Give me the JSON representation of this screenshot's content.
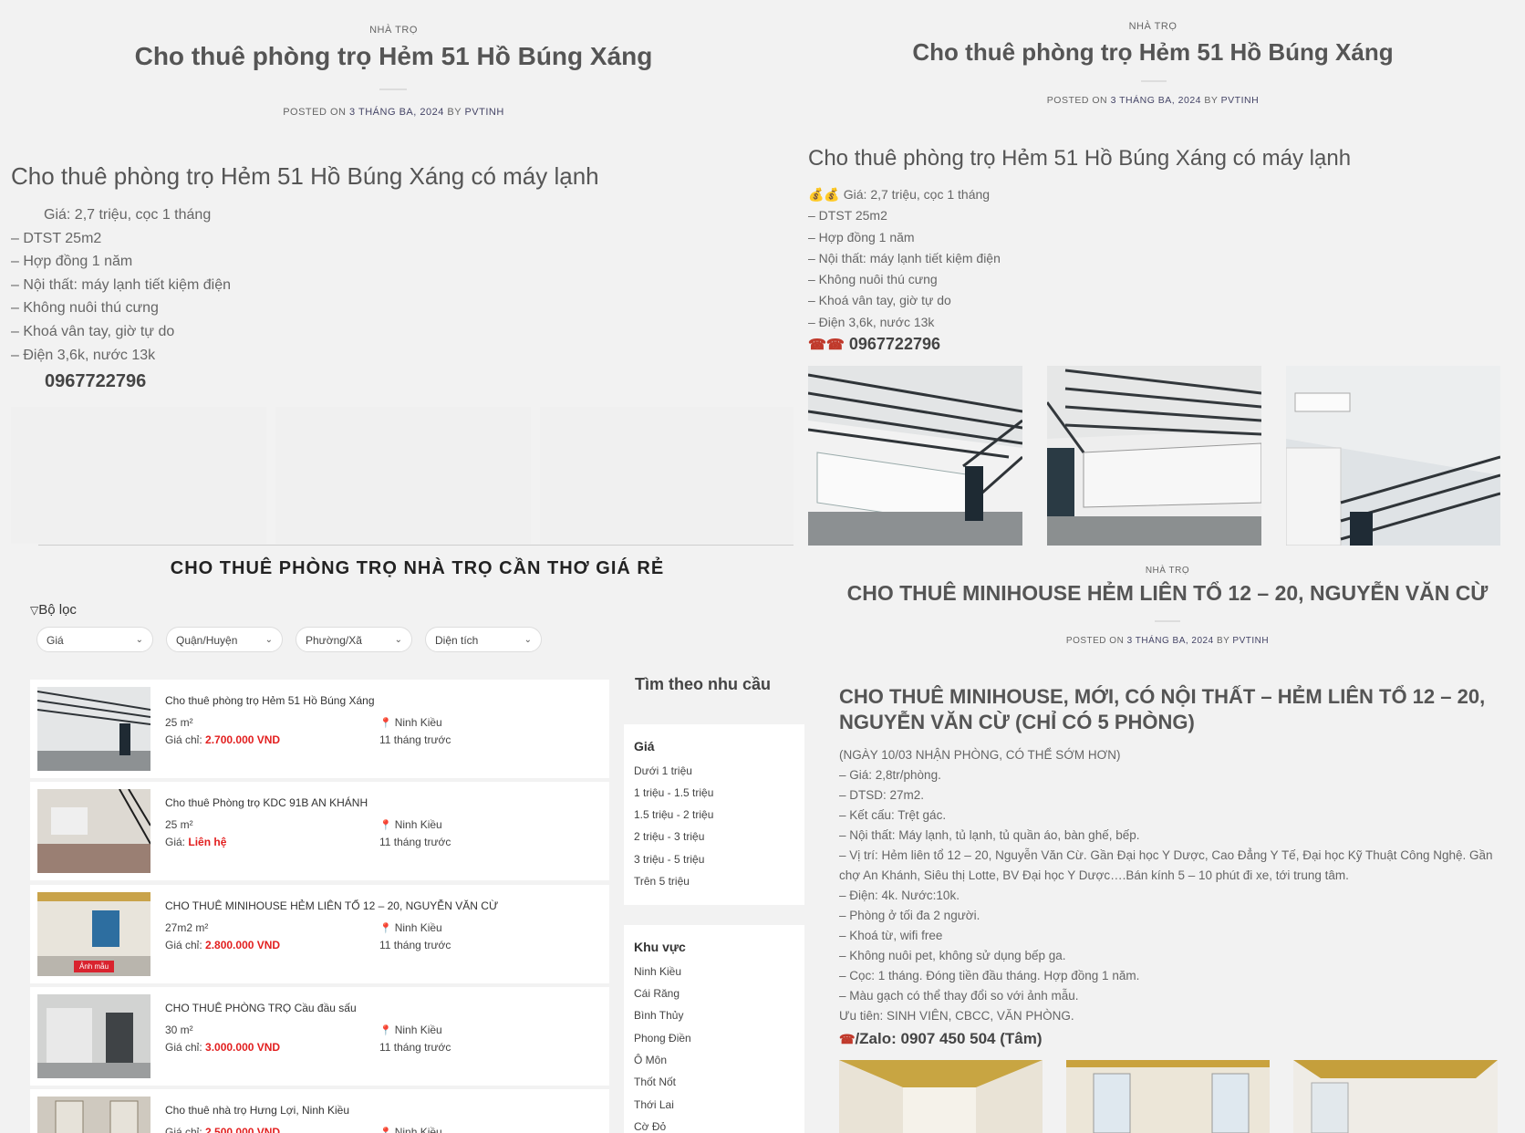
{
  "post1": {
    "category": "NHÀ TRỌ",
    "title": "Cho thuê phòng trọ Hẻm 51 Hồ Búng Xáng",
    "meta_prefix": "POSTED ON",
    "date": "3 THÁNG BA, 2024",
    "meta_by": "BY",
    "author": "PVTINH",
    "heading": "Cho thuê phòng trọ Hẻm 51 Hồ Búng Xáng có máy lạnh",
    "lines": [
      "Giá: 2,7 triệu, cọc 1 tháng",
      "– DTST 25m2",
      "– Hợp đồng 1 năm",
      "– Nội thất: máy lạnh tiết kiệm điện",
      "– Không nuôi thú cưng",
      "– Khoá vân tay, giờ tự do",
      "– Điện 3,6k, nước 13k"
    ],
    "phone": "0967722796"
  },
  "post2": {
    "category": "NHÀ TRỌ",
    "title": "Cho thuê phòng trọ Hẻm 51 Hồ Búng Xáng",
    "meta_prefix": "POSTED ON",
    "date": "3 THÁNG BA, 2024",
    "meta_by": "BY",
    "author": "PVTINH",
    "heading": "Cho thuê phòng trọ Hẻm 51 Hồ Búng Xáng có máy lạnh",
    "lines": [
      "💰💰 Giá: 2,7 triệu, cọc 1 tháng",
      "– DTST 25m2",
      "– Hợp đồng 1 năm",
      "– Nội thất: máy lạnh tiết kiệm điện",
      "– Không nuôi thú cưng",
      "– Khoá vân tay, giờ tự do",
      "– Điện 3,6k, nước 13k"
    ],
    "phone_icon": "☎☎",
    "phone": "0967722796"
  },
  "listing": {
    "title": "CHO THUÊ PHÒNG TRỌ NHÀ TRỌ CẦN THƠ GIÁ RẺ",
    "filter_label": "Bộ lọc",
    "filters": [
      "Giá",
      "Quận/Huyện",
      "Phường/Xã",
      "Diện tích"
    ],
    "cards": [
      {
        "title": "Cho thuê phòng trọ Hẻm 51 Hồ Búng Xáng",
        "area": "25 m²",
        "price_label": "Giá chỉ:",
        "price": "2.700.000 VND",
        "location": "Ninh Kiều",
        "time": "11 tháng trước"
      },
      {
        "title": "Cho thuê Phòng trọ KDC 91B AN KHÁNH",
        "area": "25 m²",
        "price_label": "Giá:",
        "price": "Liên hệ",
        "location": "Ninh Kiều",
        "time": "11 tháng trước"
      },
      {
        "title": "CHO THUÊ MINIHOUSE HẺM LIÊN TỔ 12 – 20, NGUYỄN VĂN CỪ",
        "area": "27m2 m²",
        "price_label": "Giá chỉ:",
        "price": "2.800.000 VND",
        "location": "Ninh Kiều",
        "time": "11 tháng trước",
        "badge": "Ảnh mẫu"
      },
      {
        "title": "CHO THUÊ PHÒNG TRỌ Cầu đầu sấu",
        "area": "30 m²",
        "price_label": "Giá chỉ:",
        "price": "3.000.000 VND",
        "location": "Ninh Kiều",
        "time": "11 tháng trước"
      },
      {
        "title": "Cho thuê nhà trọ Hưng Lợi, Ninh Kiều",
        "area": "",
        "price_label": "Giá chỉ:",
        "price": "2.500.000 VND",
        "location": "Ninh Kiều",
        "time": ""
      }
    ]
  },
  "sidebar": {
    "title": "Tìm theo nhu cầu",
    "price_title": "Giá",
    "price_items": [
      "Dưới 1 triệu",
      "1 triệu - 1.5 triệu",
      "1.5 triệu - 2 triệu",
      "2 triệu - 3 triệu",
      "3 triệu - 5 triệu",
      "Trên 5 triệu"
    ],
    "area_title": "Khu vực",
    "area_items": [
      "Ninh Kiều",
      "Cái Răng",
      "Bình Thủy",
      "Phong Điền",
      "Ô Môn",
      "Thốt Nốt",
      "Thới Lai",
      "Cờ Đỏ"
    ]
  },
  "post3": {
    "category": "NHÀ TRỌ",
    "title": "CHO THUÊ MINIHOUSE HẺM LIÊN TỔ 12 – 20, NGUYỄN VĂN CỪ",
    "meta_prefix": "POSTED ON",
    "date": "3 THÁNG BA, 2024",
    "meta_by": "BY",
    "author": "PVTINH",
    "heading_line1": "CHO THUÊ MINIHOUSE, MỚI, CÓ NỘI THẤT – HẺM LIÊN TỔ 12 – 20,",
    "heading_line2": "NGUYỄN VĂN CỪ (CHỈ CÓ 5 PHÒNG)",
    "lines": [
      "(NGÀY 10/03 NHẬN PHÒNG, CÓ THỂ SỚM HƠN)",
      "– Giá: 2,8tr/phòng.",
      "– DTSD: 27m2.",
      "– Kết cấu: Trệt gác.",
      "– Nội thất: Máy lạnh, tủ lạnh, tủ quần áo, bàn ghế, bếp.",
      "– Vị trí: Hẻm liên tổ 12 – 20, Nguyễn Văn Cừ. Gần Đại học Y Dược, Cao Đẳng Y Tế, Đại học Kỹ Thuật Công Nghệ. Gần",
      "chợ An Khánh, Siêu thị Lotte, BV Đại học Y Dược….Bán kính 5 – 10 phút đi xe, tới trung tâm.",
      "– Điện: 4k. Nước:10k.",
      "– Phòng ở tối đa 2 người.",
      "– Khoá từ, wifi free",
      "– Không nuôi pet, không sử dụng bếp ga.",
      "– Cọc: 1 tháng. Đóng tiền đầu tháng. Hợp đồng 1 năm.",
      "– Màu gạch có thể thay đổi so với ảnh mẫu.",
      "Ưu tiên: SINH VIÊN, CBCC, VĂN PHÒNG."
    ],
    "phone_icon": "☎",
    "phone": "/Zalo: 0907 450 504 (Tâm)"
  }
}
